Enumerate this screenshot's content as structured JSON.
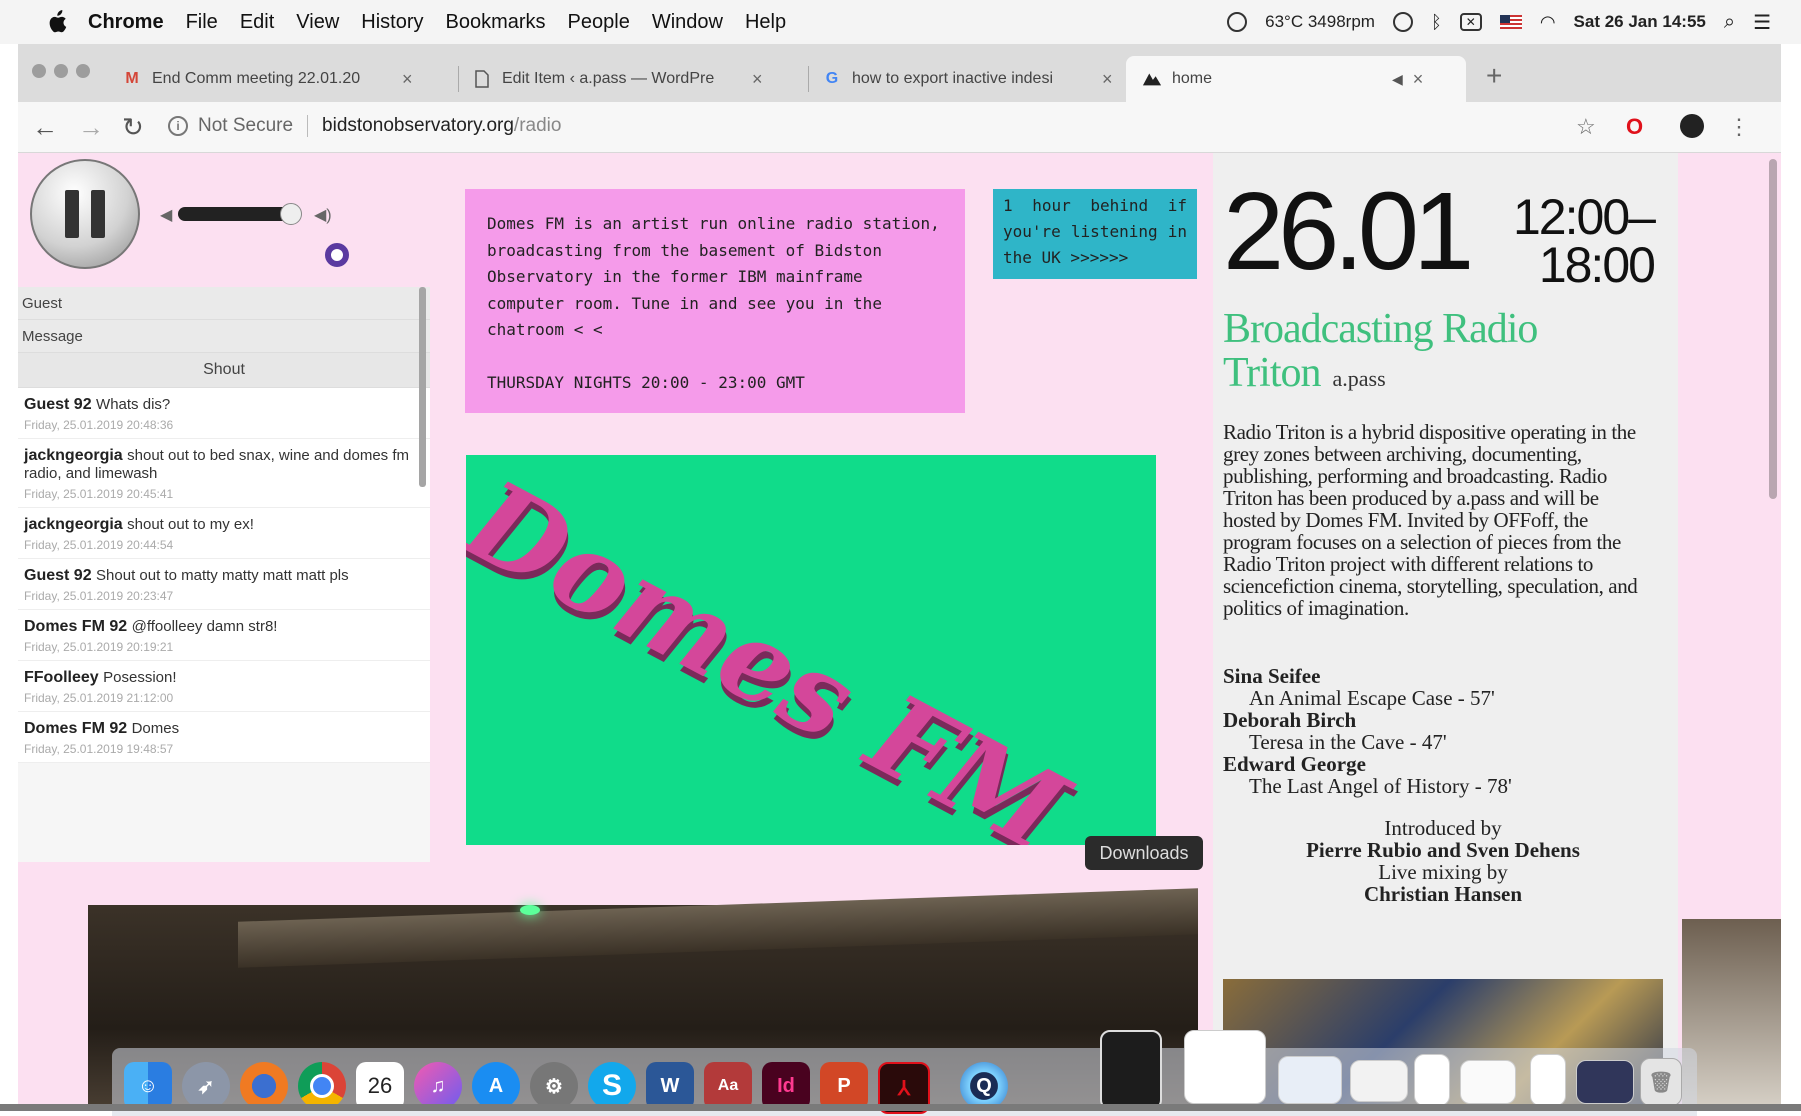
{
  "menubar": {
    "app": "Chrome",
    "items": [
      "File",
      "Edit",
      "View",
      "History",
      "Bookmarks",
      "People",
      "Window",
      "Help"
    ],
    "status_temp": "63°C 3498rpm",
    "datetime": "Sat 26 Jan  14:55"
  },
  "tabs": [
    {
      "title": "End Comm meeting 22.01.20",
      "icon": "gmail-icon"
    },
    {
      "title": "Edit Item ‹ a.pass — WordPre",
      "icon": "document-icon"
    },
    {
      "title": "how to export inactive indesi",
      "icon": "google-icon"
    },
    {
      "title": "home",
      "icon": "domes-fm-icon"
    }
  ],
  "address": {
    "security": "Not Secure",
    "host": "bidstonobservatory.org",
    "path": "/radio"
  },
  "chat": {
    "guest_placeholder": "Guest",
    "message_placeholder": "Message",
    "shout_label": "Shout",
    "messages": [
      {
        "who": "Guest 92",
        "text": "Whats dis?",
        "date": "Friday, 25.01.2019 20:48:36"
      },
      {
        "who": "jackngeorgia",
        "text": "shout out to bed snax, wine and domes fm radio, and limewash",
        "date": "Friday, 25.01.2019 20:45:41"
      },
      {
        "who": "jackngeorgia",
        "text": "shout out to my ex!",
        "date": "Friday, 25.01.2019 20:44:54"
      },
      {
        "who": "Guest 92",
        "text": "Shout out to matty matty matt matt pls",
        "date": "Friday, 25.01.2019 20:23:47"
      },
      {
        "who": "Domes FM 92",
        "text": "@ffoolleey damn str8!",
        "date": "Friday, 25.01.2019 20:19:21"
      },
      {
        "who": "FFoolleey",
        "text": "Posession!",
        "date": "Friday, 25.01.2019 21:12:00"
      },
      {
        "who": "Domes FM 92",
        "text": "Domes",
        "date": "Friday, 25.01.2019 19:48:57"
      }
    ]
  },
  "info": {
    "text": "Domes FM is an artist run online radio station, broadcasting from the basement of Bidston Observatory in the former IBM mainframe computer room. Tune in and see you in the chatroom < <",
    "schedule": "THURSDAY NIGHTS 20:00 - 23:00 GMT"
  },
  "timenote": "1 hour behind if you're listening in the UK >>>>>>",
  "logo_text": "Domes FM",
  "event": {
    "date": "26.01",
    "time_start": "12:00–",
    "time_end": "18:00",
    "title": "Broadcasting Radio Triton",
    "by": "a.pass",
    "description": "Radio Triton is a hybrid dispositive operating in the grey zones between archiving, documenting, publishing, performing and broadcasting. Radio Triton has been produced by a.pass and will be hosted by Domes FM. Invited by OFFoff, the program focuses on a selection of pieces from the Radio Triton project with different relations to sciencefiction cinema, storytelling, speculation, and politics of imagination.",
    "program": [
      {
        "artist": "Sina Seifee",
        "work": "An Animal Escape Case - 57'"
      },
      {
        "artist": "Deborah Birch",
        "work": "Teresa in the Cave - 47'"
      },
      {
        "artist": "Edward George",
        "work": "The Last Angel of History - 78'"
      }
    ],
    "introduced_label": "Introduced by",
    "introduced_by": "Pierre Rubio and Sven Dehens",
    "mixing_label": "Live mixing by",
    "mixing_by": "Christian Hansen"
  },
  "downloads_label": "Downloads",
  "dock": [
    "finder-icon",
    "launchpad-icon",
    "firefox-icon",
    "chrome-icon",
    "calendar-icon",
    "itunes-icon",
    "app-store-icon",
    "system-preferences-icon",
    "skype-icon",
    "word-icon",
    "dictionary-icon",
    "indesign-icon",
    "powerpoint-icon",
    "acrobat-icon",
    "quicktime-icon"
  ],
  "calendar_day": "26",
  "colors": {
    "page_bg": "#fce0f1",
    "info_box": "#f59bea",
    "time_box": "#2fb5c8",
    "logo_bg": "#10dc8a",
    "title_green": "#3fc07e"
  }
}
